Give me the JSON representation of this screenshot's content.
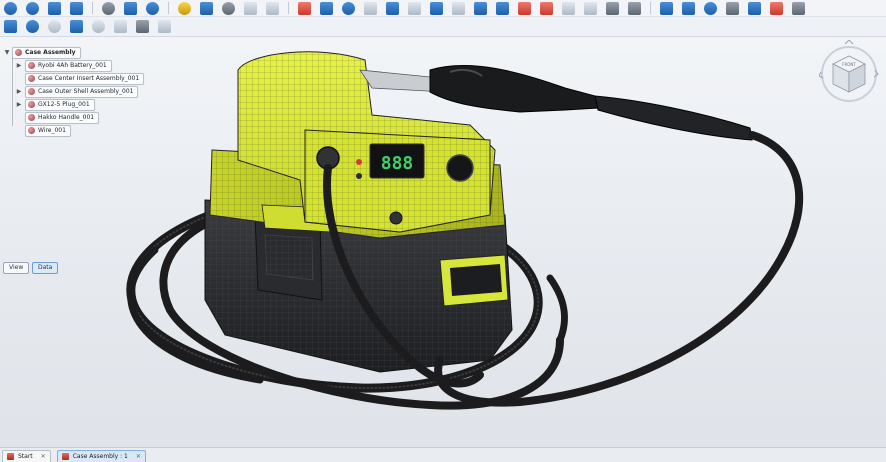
{
  "toolbar_top": {
    "icons": [
      "zoom-in-icon",
      "zoom-out-icon",
      "view-cube-icon",
      "zoom-window-icon",
      "section-icon",
      "box-icon",
      "zoom-fit-icon",
      "separator",
      "sun-icon",
      "folder-icon",
      "gear-icon",
      "cube-wire-icon",
      "selector-icon",
      "separator",
      "home-icon",
      "shapes-icon",
      "sphere-icon",
      "grid-icon",
      "curve-icon",
      "surface-icon",
      "slice-icon",
      "doc-icon",
      "save-icon",
      "blue-box-icon",
      "flag-icon",
      "bookmark-icon",
      "measure-icon",
      "text-icon",
      "cylinder-icon",
      "cone-icon",
      "separator",
      "trash-icon",
      "save-as-icon",
      "globe-icon",
      "palette-icon",
      "book-icon",
      "close-panel-icon",
      "more-icon"
    ]
  },
  "toolbar_second": {
    "icons": [
      "render-mode-icon",
      "shaded-icon",
      "hidden-line-icon",
      "edges-icon",
      "transparency-icon",
      "wireframe-icon",
      "lamp-icon",
      "bulb-icon"
    ]
  },
  "tree": {
    "root": "Case Assembly",
    "items": [
      {
        "label": "Ryobi 4Ah Battery_001",
        "expandable": true
      },
      {
        "label": "Case Center Insert Assembly_001",
        "expandable": false
      },
      {
        "label": "Case Outer Shell Assembly_001",
        "expandable": true
      },
      {
        "label": "GX12-5 Plug_001",
        "expandable": true
      },
      {
        "label": "Hakko Handle_001",
        "expandable": false
      },
      {
        "label": "Wire_001",
        "expandable": false
      }
    ]
  },
  "view_buttons": {
    "view": "View",
    "data": "Data"
  },
  "viewcube": {
    "face": "FRONT"
  },
  "display": {
    "digits": "888"
  },
  "colors": {
    "body": "#d6e63a",
    "base": "#2b2d30",
    "cable": "#1c1c1e",
    "display_digit": "#3fd06a"
  },
  "status_tabs": [
    {
      "label": "Start",
      "active": false
    },
    {
      "label": "Case Assembly : 1",
      "active": true
    }
  ]
}
